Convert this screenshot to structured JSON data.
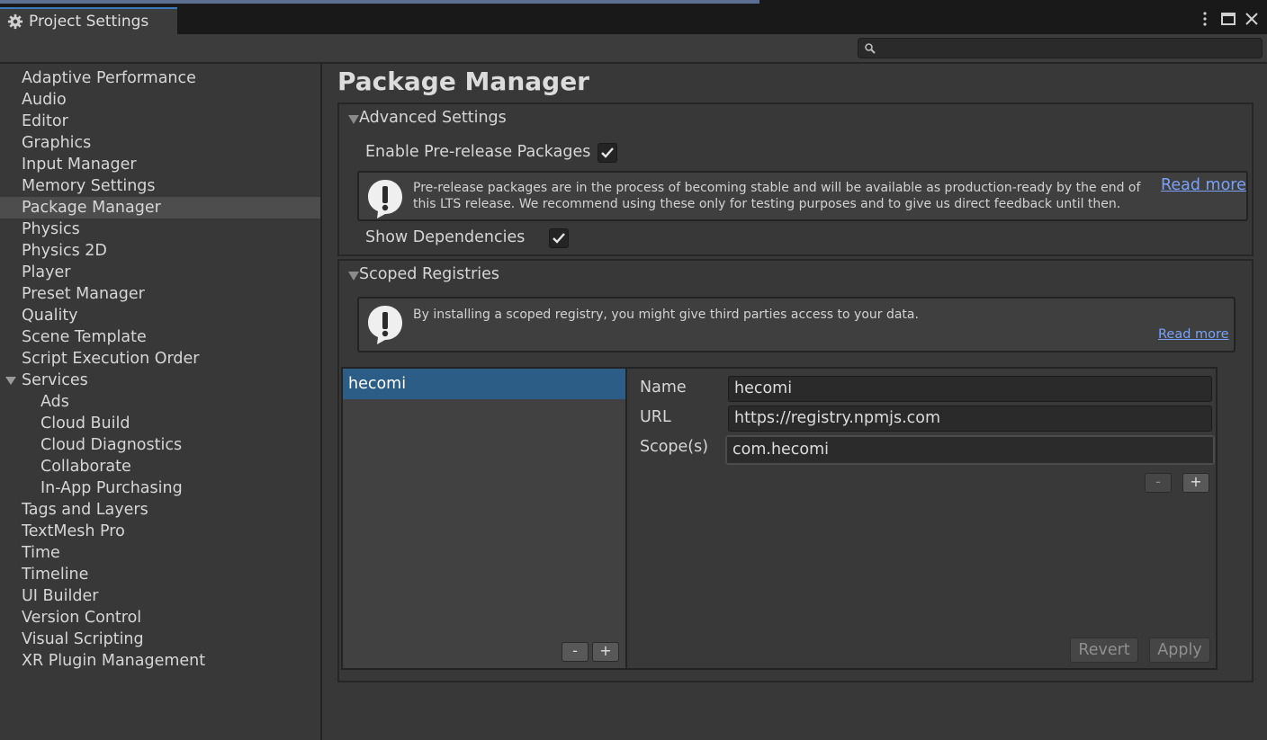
{
  "window": {
    "tab_title": "Project Settings",
    "icons": [
      "gear-icon",
      "kebab-menu-icon",
      "maximize-icon",
      "close-icon"
    ]
  },
  "search": {
    "placeholder": "",
    "value": "",
    "icon": "search-icon"
  },
  "sidebar": {
    "items": [
      {
        "label": "Adaptive Performance"
      },
      {
        "label": "Audio"
      },
      {
        "label": "Editor"
      },
      {
        "label": "Graphics"
      },
      {
        "label": "Input Manager"
      },
      {
        "label": "Memory Settings"
      },
      {
        "label": "Package Manager",
        "selected": true
      },
      {
        "label": "Physics"
      },
      {
        "label": "Physics 2D"
      },
      {
        "label": "Player"
      },
      {
        "label": "Preset Manager"
      },
      {
        "label": "Quality"
      },
      {
        "label": "Scene Template"
      },
      {
        "label": "Script Execution Order"
      },
      {
        "label": "Services",
        "expanded": true
      },
      {
        "label": "Ads",
        "indent": 1
      },
      {
        "label": "Cloud Build",
        "indent": 1
      },
      {
        "label": "Cloud Diagnostics",
        "indent": 1
      },
      {
        "label": "Collaborate",
        "indent": 1
      },
      {
        "label": "In-App Purchasing",
        "indent": 1
      },
      {
        "label": "Tags and Layers"
      },
      {
        "label": "TextMesh Pro"
      },
      {
        "label": "Time"
      },
      {
        "label": "Timeline"
      },
      {
        "label": "UI Builder"
      },
      {
        "label": "Version Control"
      },
      {
        "label": "Visual Scripting"
      },
      {
        "label": "XR Plugin Management"
      }
    ]
  },
  "main": {
    "title": "Package Manager",
    "advanced": {
      "header": "Advanced Settings",
      "prerelease_label": "Enable Pre-release Packages",
      "prerelease_checked": true,
      "help_text": "Pre-release packages are in the process of becoming stable and will be available as production-ready by the end of this LTS release. We recommend using these only for testing purposes and to give us direct feedback until then.",
      "read_more": "Read more",
      "dependencies_label": "Show Dependencies",
      "dependencies_checked": true
    },
    "scoped": {
      "header": "Scoped Registries",
      "help_text": "By installing a scoped registry, you might give third parties access to your data.",
      "read_more": "Read more",
      "registries": [
        {
          "name": "hecomi",
          "selected": true
        }
      ],
      "list_minus": "-",
      "list_plus": "+",
      "name_label": "Name",
      "name_value": "hecomi",
      "url_label": "URL",
      "url_value": "https://registry.npmjs.com",
      "scope_label": "Scope(s)",
      "scope_value": "com.hecomi",
      "scope_minus": "-",
      "scope_plus": "+",
      "revert_label": "Revert",
      "apply_label": "Apply"
    }
  }
}
